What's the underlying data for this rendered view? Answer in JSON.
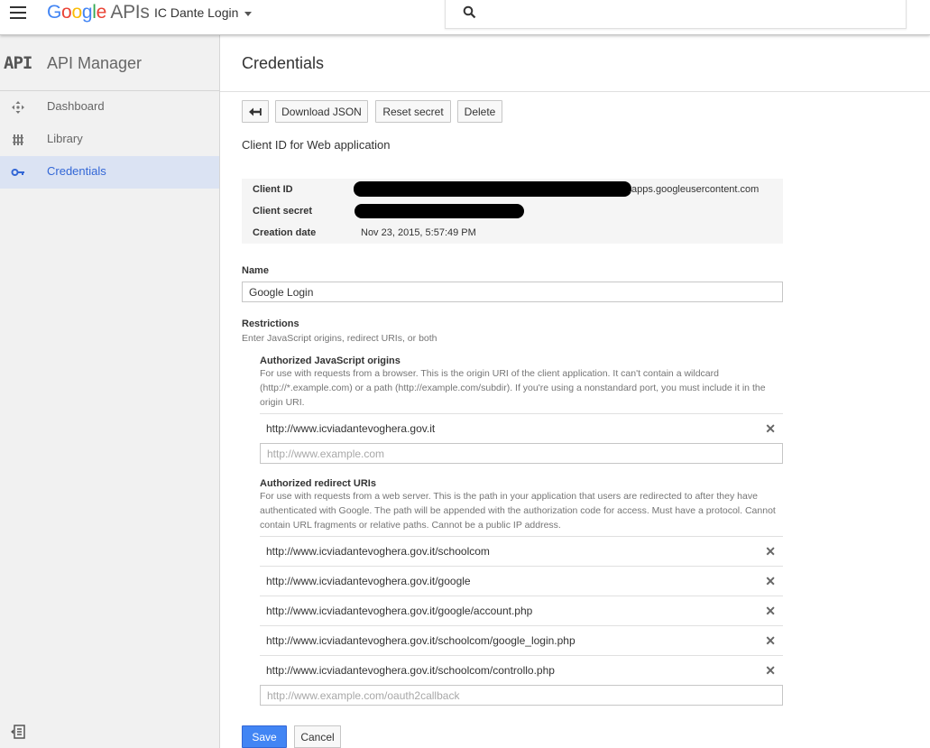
{
  "topbar": {
    "logo_google": [
      "G",
      "o",
      "o",
      "g",
      "l",
      "e"
    ],
    "logo_apis": "APIs",
    "project": "IC Dante Login"
  },
  "sidebar": {
    "title": "API Manager",
    "glyph": "API",
    "items": [
      {
        "label": "Dashboard",
        "icon": "dashboard-icon",
        "active": false
      },
      {
        "label": "Library",
        "icon": "library-icon",
        "active": false
      },
      {
        "label": "Credentials",
        "icon": "key-icon",
        "active": true
      }
    ]
  },
  "page": {
    "title": "Credentials",
    "buttons": {
      "download": "Download JSON",
      "reset": "Reset secret",
      "delete": "Delete"
    },
    "subtitle": "Client ID for Web application",
    "info": {
      "client_id_label": "Client ID",
      "client_id_suffix": ".apps.googleusercontent.com",
      "client_secret_label": "Client secret",
      "creation_label": "Creation date",
      "creation_value": "Nov 23, 2015, 5:57:49 PM"
    },
    "name_label": "Name",
    "name_value": "Google Login",
    "restrictions_label": "Restrictions",
    "restrictions_help": "Enter JavaScript origins, redirect URIs, or both",
    "js_origins": {
      "label": "Authorized JavaScript origins",
      "help": "For use with requests from a browser. This is the origin URI of the client application. It can't contain a wildcard (http://*.example.com) or a path (http://example.com/subdir). If you're using a nonstandard port, you must include it in the origin URI.",
      "items": [
        "http://www.icviadantevoghera.gov.it"
      ],
      "placeholder": "http://www.example.com"
    },
    "redirect_uris": {
      "label": "Authorized redirect URIs",
      "help": "For use with requests from a web server. This is the path in your application that users are redirected to after they have authenticated with Google. The path will be appended with the authorization code for access. Must have a protocol. Cannot contain URL fragments or relative paths. Cannot be a public IP address.",
      "items": [
        "http://www.icviadantevoghera.gov.it/schoolcom",
        "http://www.icviadantevoghera.gov.it/google",
        "http://www.icviadantevoghera.gov.it/google/account.php",
        "http://www.icviadantevoghera.gov.it/schoolcom/google_login.php",
        "http://www.icviadantevoghera.gov.it/schoolcom/controllo.php"
      ],
      "placeholder": "http://www.example.com/oauth2callback"
    },
    "save": "Save",
    "cancel": "Cancel"
  }
}
